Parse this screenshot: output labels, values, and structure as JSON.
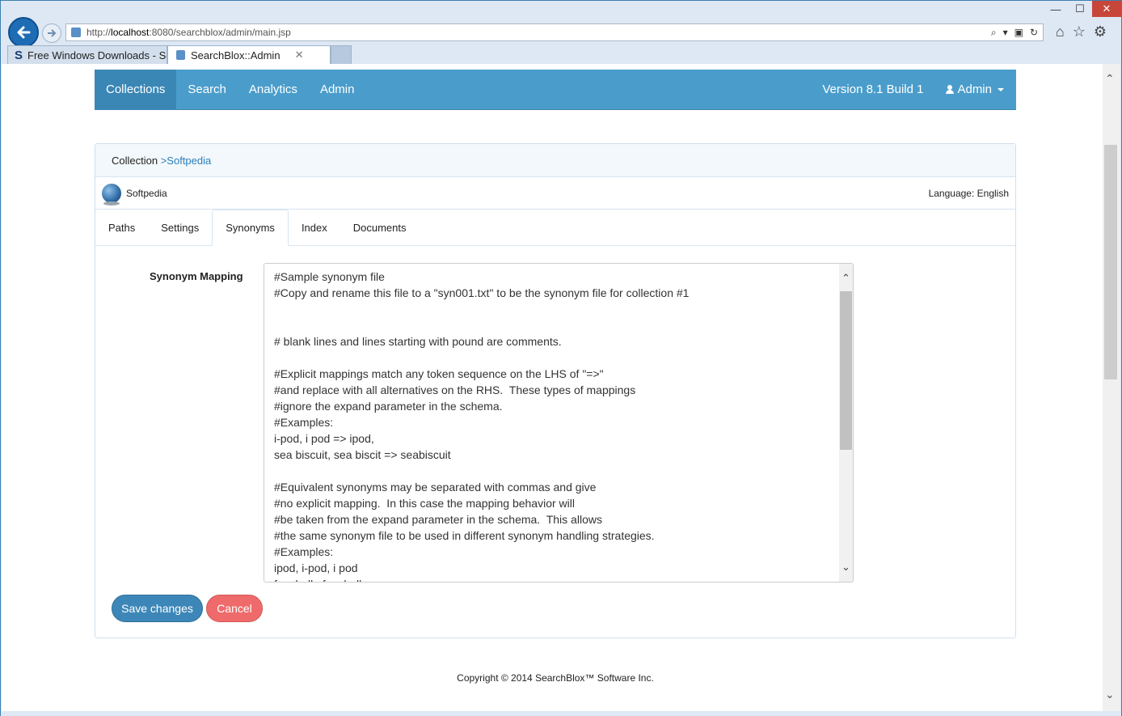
{
  "browser": {
    "url_prefix": "http://",
    "url_host": "localhost",
    "url_rest": ":8080/searchblox/admin/main.jsp",
    "tabs": [
      {
        "label": "Free Windows Downloads - So...",
        "icon": "S"
      },
      {
        "label": "SearchBlox::Admin",
        "icon": ""
      }
    ],
    "window_controls": {
      "minimize": "—",
      "maximize": "☐",
      "close": "✕"
    },
    "toolbar_icons": {
      "home": "⌂",
      "favorites": "☆",
      "settings": "⚙"
    },
    "address_tools": {
      "search": "⌕",
      "dropdown": "▾",
      "compat": "▣",
      "refresh": "↻"
    }
  },
  "nav": {
    "items": [
      "Collections",
      "Search",
      "Analytics",
      "Admin"
    ],
    "active_index": 0,
    "version": "Version 8.1 Build 1",
    "user": "Admin"
  },
  "collection": {
    "breadcrumb_label": "Collection",
    "breadcrumb_link": ">Softpedia",
    "name": "Softpedia",
    "language": "Language: English"
  },
  "tabs": [
    "Paths",
    "Settings",
    "Synonyms",
    "Index",
    "Documents"
  ],
  "active_tab": "Synonyms",
  "form": {
    "label": "Synonym Mapping",
    "text": "#Sample synonym file\n#Copy and rename this file to a \"syn001.txt\" to be the synonym file for collection #1\n\n\n# blank lines and lines starting with pound are comments.\n\n#Explicit mappings match any token sequence on the LHS of \"=>\"\n#and replace with all alternatives on the RHS.  These types of mappings\n#ignore the expand parameter in the schema.\n#Examples:\ni-pod, i pod => ipod,\nsea biscuit, sea biscit => seabiscuit\n\n#Equivalent synonyms may be separated with commas and give\n#no explicit mapping.  In this case the mapping behavior will\n#be taken from the expand parameter in the schema.  This allows\n#the same synonym file to be used in different synonym handling strategies.\n#Examples:\nipod, i-pod, i pod\nfoozball , foosball"
  },
  "buttons": {
    "save": "Save changes",
    "cancel": "Cancel"
  },
  "footer": "Copyright © 2014 SearchBlox™ Software Inc.",
  "colors": {
    "nav_bg": "#4a9dcb",
    "nav_active": "#3a87b6",
    "save": "#3d87b8",
    "cancel": "#ef6b6b",
    "link": "#2a7fb8"
  }
}
